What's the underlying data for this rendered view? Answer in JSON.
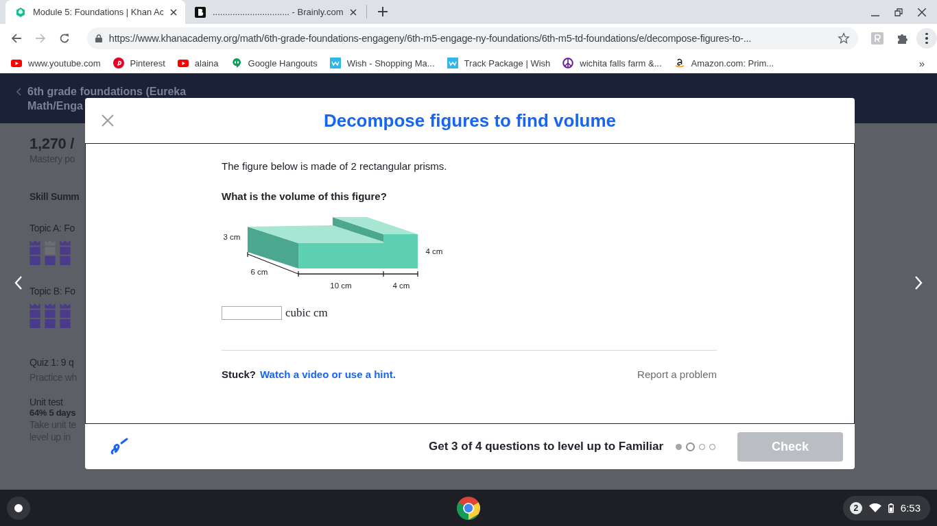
{
  "browser": {
    "tabs": [
      {
        "title": "Module 5: Foundations | Khan Ac",
        "kind": "khan",
        "selected": true
      },
      {
        "title": "............................... - Brainly.com",
        "kind": "brainly",
        "selected": false
      }
    ],
    "url": "https://www.khanacademy.org/math/6th-grade-foundations-engageny/6th-m5-engage-ny-foundations/6th-m5-td-foundations/e/decompose-figures-to-...",
    "bookmarks": [
      {
        "label": "www.youtube.com",
        "kind": "youtube"
      },
      {
        "label": "Pinterest",
        "kind": "pinterest"
      },
      {
        "label": "alaina",
        "kind": "youtube"
      },
      {
        "label": "Google Hangouts",
        "kind": "hangouts"
      },
      {
        "label": "Wish - Shopping Ma...",
        "kind": "wish"
      },
      {
        "label": "Track Package | Wish",
        "kind": "wish"
      },
      {
        "label": "wichita falls farm &...",
        "kind": "peace"
      },
      {
        "label": "Amazon.com: Prim...",
        "kind": "amazon"
      }
    ],
    "more_bookmarks": "»"
  },
  "background_page": {
    "course_title": "6th grade foundations (Eureka Math/Enga",
    "points": "1,270 /",
    "points_label": "Mastery po",
    "section_title": "Skill Summ",
    "topics": [
      {
        "title": "Topic A: Fo",
        "skills": [
          {
            "mastered": true
          },
          {
            "mastered": false
          },
          {
            "mastered": true
          }
        ]
      },
      {
        "title": "Topic B: Fo",
        "skills": [
          {
            "mastered": true
          },
          {
            "mastered": true
          },
          {
            "mastered": true
          }
        ]
      }
    ],
    "quiz": {
      "title": "Quiz 1: 9 q",
      "text": "Practice wh"
    },
    "unit_test": {
      "title": "Unit test",
      "score": "64% 5 days",
      "text_lines": [
        "Take unit te",
        "level up in"
      ]
    }
  },
  "modal": {
    "title": "Decompose figures to find volume",
    "intro": "The figure below is made of 2 rectangular prisms.",
    "question": "What is the volume of this figure?",
    "figure_labels": [
      {
        "text": "3 cm",
        "kind": "height_left"
      },
      {
        "text": "6 cm",
        "kind": "depth"
      },
      {
        "text": "10 cm",
        "kind": "length_front"
      },
      {
        "text": "4 cm",
        "kind": "length_right"
      },
      {
        "text": "4 cm",
        "kind": "height_right"
      }
    ],
    "answer": {
      "unit": "cubic cm"
    },
    "stuck": "Stuck?",
    "hint_link": "Watch a video or use a hint.",
    "report": "Report a problem",
    "goal": "Get 3 of 4 questions to level up to Familiar",
    "progress": [
      {
        "kind": "done"
      },
      {
        "kind": "current"
      },
      {
        "kind": "todo"
      },
      {
        "kind": "todo"
      }
    ],
    "check": {
      "label": "Check",
      "disabled": true
    }
  },
  "taskbar": {
    "notifications": "2",
    "time": "6:53"
  }
}
